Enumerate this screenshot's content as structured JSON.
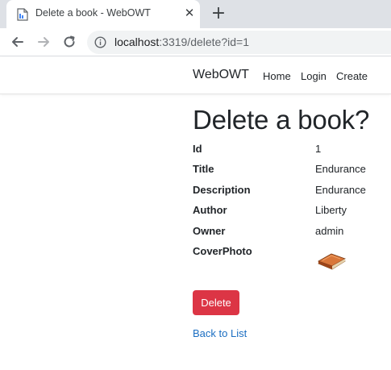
{
  "browser": {
    "tab_title": "Delete a book - WebOWT",
    "close_glyph": "✕",
    "new_tab_glyph": "+",
    "url_host": "localhost",
    "url_rest": ":3319/delete?id=1"
  },
  "navbar": {
    "brand": "WebOWT",
    "links": [
      "Home",
      "Login",
      "Create"
    ]
  },
  "page": {
    "title": "Delete a book?",
    "fields": [
      {
        "label": "Id",
        "value": "1"
      },
      {
        "label": "Title",
        "value": "Endurance"
      },
      {
        "label": "Description",
        "value": "Endurance"
      },
      {
        "label": "Author",
        "value": "Liberty"
      },
      {
        "label": "Owner",
        "value": "admin"
      },
      {
        "label": "CoverPhoto",
        "value": ""
      }
    ],
    "cover_icon": "book-icon",
    "delete_label": "Delete",
    "back_label": "Back to List"
  },
  "colors": {
    "danger": "#dc3545",
    "link": "#1b6ec2",
    "tabstrip": "#dee1e6"
  }
}
